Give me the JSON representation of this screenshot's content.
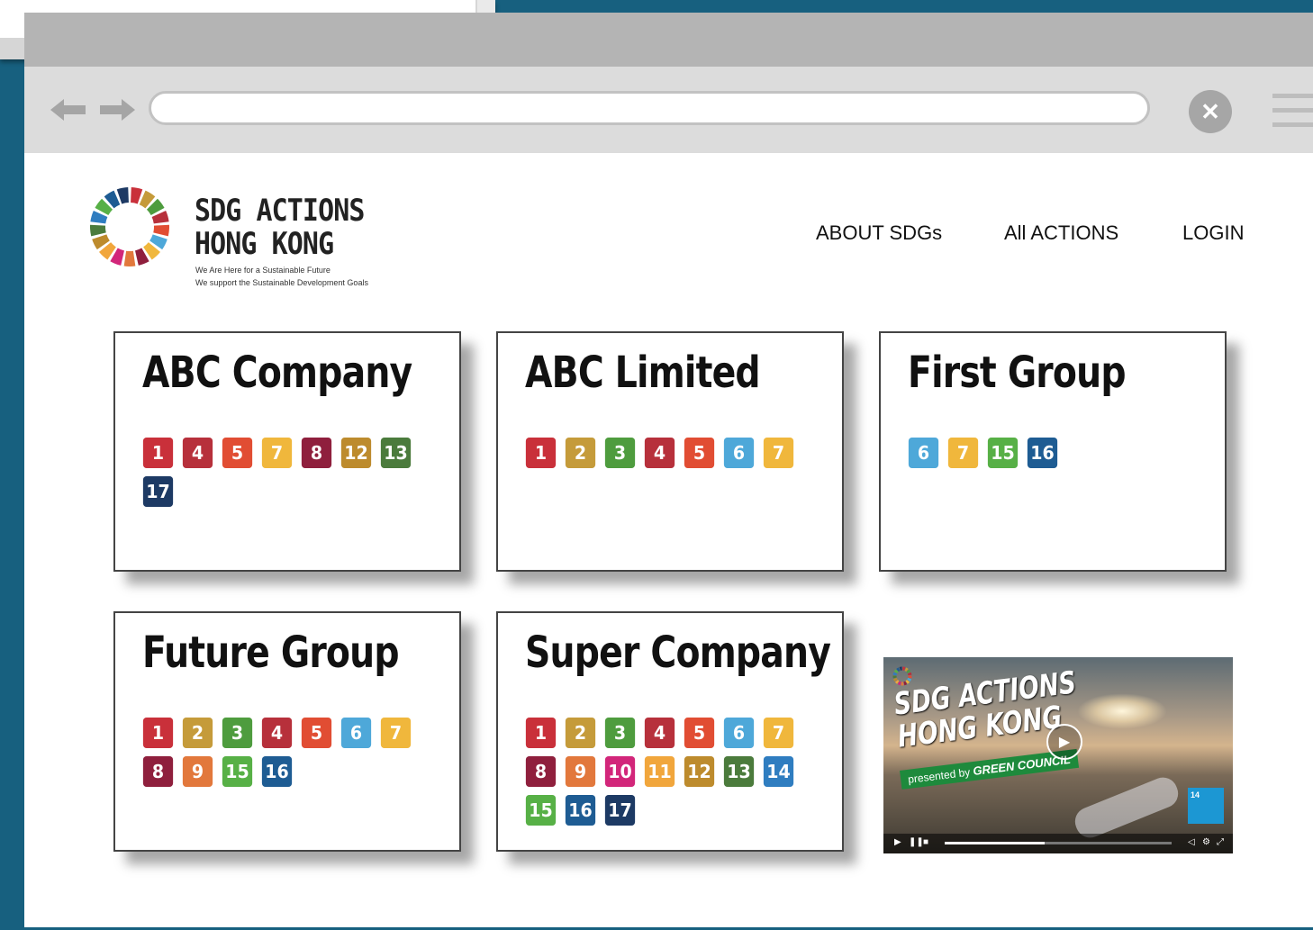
{
  "browser": {
    "url": "",
    "close_symbol": "✕"
  },
  "logo": {
    "title_line1": "SDG ACTIONS",
    "title_line2": "HONG  KONG",
    "tagline1": "We Are Here for a Sustainable Future",
    "tagline2": "We support the Sustainable Development Goals"
  },
  "nav": {
    "about": "ABOUT SDGs",
    "all_actions": "All ACTIONS",
    "login": "LOGIN"
  },
  "sdg_colors": {
    "1": "#c9303a",
    "2": "#c59b3a",
    "3": "#4e9c3e",
    "4": "#b7303b",
    "5": "#e14d33",
    "6": "#4ea8d9",
    "7": "#f0b73c",
    "8": "#8f1f3d",
    "9": "#e2783c",
    "10": "#d2267a",
    "11": "#f1a63c",
    "12": "#bd8b2d",
    "13": "#4b7b3c",
    "14": "#2f7dc0",
    "15": "#57b046",
    "16": "#1e5c93",
    "17": "#1d3a64"
  },
  "cards": [
    {
      "title": "ABC Company",
      "goals": [
        1,
        4,
        5,
        7,
        8,
        12,
        13,
        17
      ]
    },
    {
      "title": "ABC Limited",
      "goals": [
        1,
        2,
        3,
        4,
        5,
        6,
        7
      ]
    },
    {
      "title": "First Group",
      "goals": [
        6,
        7,
        15,
        16
      ]
    },
    {
      "title": "Future Group",
      "goals": [
        1,
        2,
        3,
        4,
        5,
        6,
        7,
        8,
        9,
        15,
        16
      ]
    },
    {
      "title": "Super Company",
      "goals": [
        1,
        2,
        3,
        4,
        5,
        6,
        7,
        8,
        9,
        10,
        11,
        12,
        13,
        14,
        15,
        16,
        17
      ]
    }
  ],
  "video": {
    "title_line1": "SDG ACTIONS",
    "title_line2": "HONG  KONG",
    "presented_by": "presented by",
    "presenter": "GREEN COUNCIL",
    "goal_badge": "14",
    "progress": 0.44
  }
}
